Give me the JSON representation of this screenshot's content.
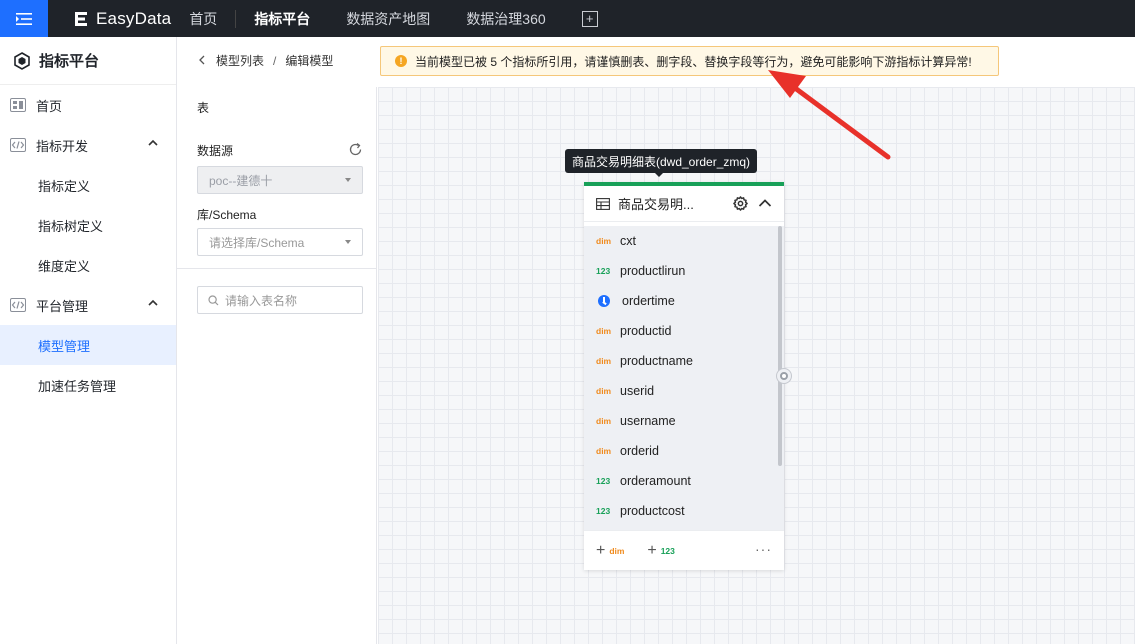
{
  "topbar": {
    "logo_text": "EasyData",
    "nav": [
      {
        "label": "首页"
      },
      {
        "label": "指标平台"
      },
      {
        "label": "数据资产地图"
      },
      {
        "label": "数据治理360"
      }
    ]
  },
  "sidebar": {
    "title": "指标平台",
    "home": "首页",
    "group_dev": "指标开发",
    "dev_items": [
      "指标定义",
      "指标树定义",
      "维度定义"
    ],
    "group_admin": "平台管理",
    "admin_items": [
      "模型管理",
      "加速任务管理"
    ]
  },
  "breadcrumb": {
    "parent": "模型列表",
    "separator": "/",
    "current": "编辑模型"
  },
  "alert": {
    "text": "当前模型已被 5 个指标所引用，请谨慎删表、删字段、替换字段等行为，避免可能影响下游指标计算异常!"
  },
  "panel": {
    "section_title": "表",
    "datasource_label": "数据源",
    "datasource_value": "poc--建德十",
    "schema_label": "库/Schema",
    "schema_placeholder": "请选择库/Schema",
    "search_placeholder": "请输入表名称"
  },
  "tooltip": "商品交易明细表(dwd_order_zmq)",
  "table_card": {
    "name": "商品交易明...",
    "fields": [
      {
        "type": "dim",
        "badge": "dim",
        "name": "cxt"
      },
      {
        "type": "num",
        "badge": "123",
        "name": "productlirun"
      },
      {
        "type": "time",
        "badge": "",
        "name": "ordertime"
      },
      {
        "type": "dim",
        "badge": "dim",
        "name": "productid"
      },
      {
        "type": "dim",
        "badge": "dim",
        "name": "productname"
      },
      {
        "type": "dim",
        "badge": "dim",
        "name": "userid"
      },
      {
        "type": "dim",
        "badge": "dim",
        "name": "username"
      },
      {
        "type": "dim",
        "badge": "dim",
        "name": "orderid"
      },
      {
        "type": "num",
        "badge": "123",
        "name": "orderamount"
      },
      {
        "type": "num",
        "badge": "123",
        "name": "productcost"
      }
    ],
    "footer": {
      "add_dim": "dim",
      "add_num": "123",
      "more": "···"
    }
  },
  "colors": {
    "accent": "#1e6fff",
    "topbar": "#1f2329",
    "card_border": "#18a058",
    "dim_badge": "#f08a1c",
    "num_badge": "#18a058",
    "alert_bg": "#fff8e6",
    "arrow": "#e8312a"
  }
}
